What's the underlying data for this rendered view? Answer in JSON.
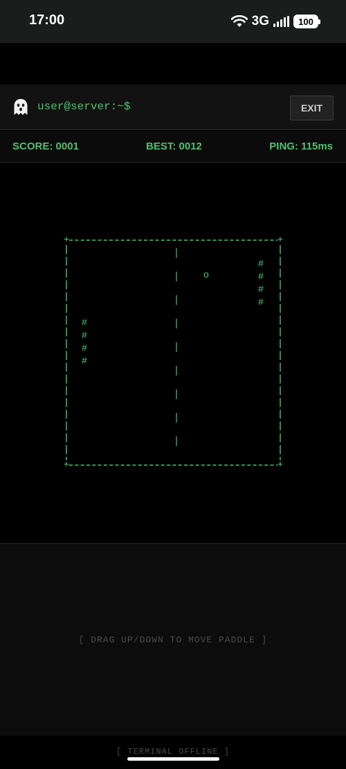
{
  "status": {
    "time": "17:00",
    "network": "3G",
    "battery": "100"
  },
  "header": {
    "prompt": "user@server:~$",
    "exit_label": "EXIT"
  },
  "scorebar": {
    "score": "SCORE: 0001",
    "best": "BEST: 0012",
    "ping": "PING: 115ms"
  },
  "game": {
    "corner_char": "+",
    "border_h_char": "-",
    "border_v_char": "|",
    "net_char": "|",
    "paddle_char": "#",
    "ball_char": "o",
    "paddle_length": 4
  },
  "controls": {
    "hint": "[ DRAG UP/DOWN TO MOVE PADDLE ]"
  },
  "footer": {
    "offline": "[ TERMINAL OFFLINE ]"
  },
  "colors": {
    "accent": "#4fc26f",
    "muted": "#4a4a4a",
    "background": "#000000"
  }
}
